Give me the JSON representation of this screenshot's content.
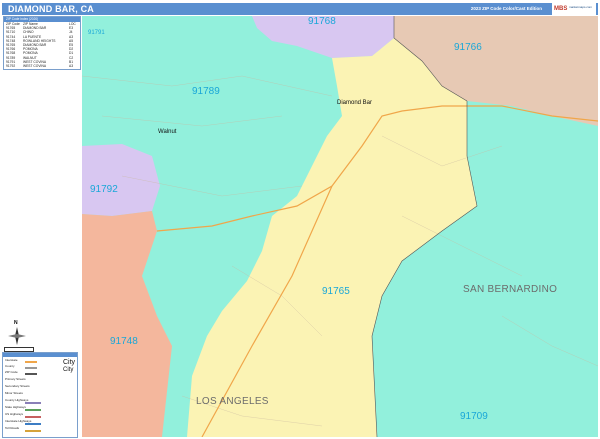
{
  "header": {
    "title": "DIAMOND BAR, CA",
    "edition": "2023 ZIP Code Color/Cast Edition",
    "logo_mark": "MBS",
    "logo_sub": "marketmaps.com"
  },
  "zip_list": {
    "header": "ZIP Code Index (2020)",
    "columns": [
      "ZIP Code",
      "ZIP Name",
      "LOC"
    ],
    "rows": [
      [
        "91765",
        "DIAMOND BAR",
        "E3"
      ],
      [
        "91710",
        "CHINO",
        "J4"
      ],
      [
        "91744",
        "LA PUENTE",
        "A3"
      ],
      [
        "91748",
        "ROWLAND HEIGHTS",
        "A5"
      ],
      [
        "91765",
        "DIAMOND BAR",
        "E5"
      ],
      [
        "91766",
        "POMONA",
        "D2"
      ],
      [
        "91768",
        "POMONA",
        "D1"
      ],
      [
        "91789",
        "WALNUT",
        "C2"
      ],
      [
        "91791",
        "WEST COVINA",
        "B1"
      ],
      [
        "91792",
        "WEST COVINA",
        "A3"
      ]
    ]
  },
  "zip_labels": [
    {
      "text": "91768",
      "color": "#1aa7d8"
    },
    {
      "text": "91766",
      "color": "#1aa7d8"
    },
    {
      "text": "91789",
      "color": "#1aa7d8"
    },
    {
      "text": "91792",
      "color": "#1aa7d8"
    },
    {
      "text": "91765",
      "color": "#1aa7d8"
    },
    {
      "text": "91748",
      "color": "#1aa7d8"
    },
    {
      "text": "91709",
      "color": "#1aa7d8"
    },
    {
      "text": "91791",
      "color": "#1aa7d8"
    }
  ],
  "city_labels": [
    "Diamond Bar",
    "Walnut"
  ],
  "county_labels": [
    "SAN BERNARDINO",
    "LOS ANGELES"
  ],
  "legend": {
    "rows": [
      "Interstate",
      "County",
      "ZIP Code",
      "Primary Streets",
      "Secondary Streets",
      "Minor Streets",
      "County Highways",
      "State Highways",
      "US Highways",
      "Interstate Highways",
      "Toll Roads"
    ],
    "city_big": "City",
    "city_small": "City"
  },
  "colors": {
    "teal": "#92f0dc",
    "yellow": "#fbf3b4",
    "purple": "#d8c7f1",
    "tan": "#e7c9b4",
    "salmon": "#f4b79d",
    "header": "#5a8fd0",
    "zip_text": "#1aa7d8"
  }
}
